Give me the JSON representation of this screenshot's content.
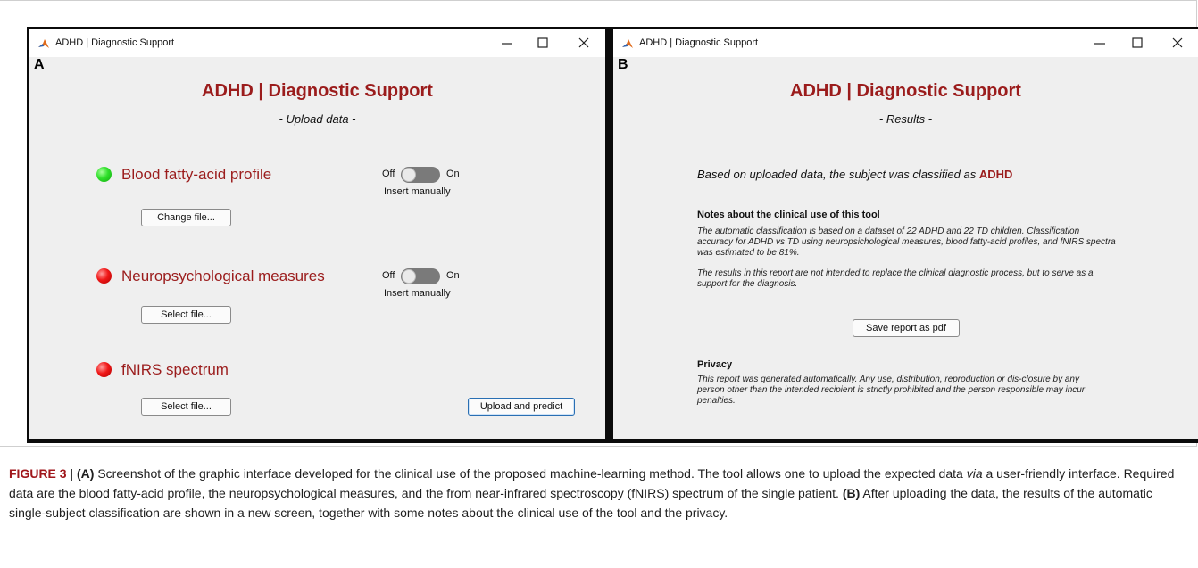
{
  "window_a": {
    "title": "ADHD | Diagnostic Support",
    "panel_letter": "A",
    "app_title": "ADHD | Diagnostic Support",
    "subtitle": "- Upload data -",
    "items": [
      {
        "label": "Blood fatty-acid profile",
        "status": "green",
        "button": "Change file...",
        "switch_off": "Off",
        "switch_on": "On",
        "manual": "Insert manually"
      },
      {
        "label": "Neuropsychological measures",
        "status": "red",
        "button": "Select file...",
        "switch_off": "Off",
        "switch_on": "On",
        "manual": "Insert manually"
      },
      {
        "label": "fNIRS spectrum",
        "status": "red",
        "button": "Select file..."
      }
    ],
    "upload_button": "Upload and predict"
  },
  "window_b": {
    "title": "ADHD | Diagnostic Support",
    "panel_letter": "B",
    "app_title": "ADHD | Diagnostic Support",
    "subtitle": "- Results -",
    "result_prefix": "Based on uploaded data, the subject was classified as",
    "result_value": "ADHD",
    "notes_heading": "Notes about the clinical use of this tool",
    "notes_p1": "The automatic classification is based on a dataset of 22 ADHD and 22 TD children. Classification accuracy for ADHD vs TD using neuropsichological measures, blood fatty-acid profiles, and fNIRS spectra was estimated to be 81%.",
    "notes_p2": "The results in this report are not intended to replace the clinical diagnostic process, but to serve as a support for the diagnosis.",
    "save_button": "Save report as pdf",
    "privacy_heading": "Privacy",
    "privacy_text": "This report was generated automatically. Any use, distribution, reproduction or dis-closure by any person other than the intended recipient is strictly prohibited and the person responsible may incur penalties."
  },
  "caption": {
    "figure_label": "FIGURE 3",
    "separator": " | ",
    "part_a_label": "(A)",
    "part_a_text": " Screenshot of the graphic interface developed for the clinical use of the proposed machine-learning method. The tool allows one to upload the expected data ",
    "via": "via",
    "part_a_text2": " a user-friendly interface. Required data are the blood fatty-acid profile, the neuropsychological measures, and the from near-infrared spectroscopy (fNIRS) spectrum of the single patient. ",
    "part_b_label": "(B)",
    "part_b_text": " After uploading the data, the results of the automatic single-subject classification are shown in a new screen, together with some notes about the clinical use of the tool and the privacy."
  },
  "colors": {
    "title_red": "#9b1c1c",
    "led_green": "#2fe02a",
    "led_red": "#f01818",
    "caption_label": "#a0171c"
  },
  "icons": [
    "matlab-icon",
    "minimize-icon",
    "maximize-icon",
    "close-icon"
  ]
}
